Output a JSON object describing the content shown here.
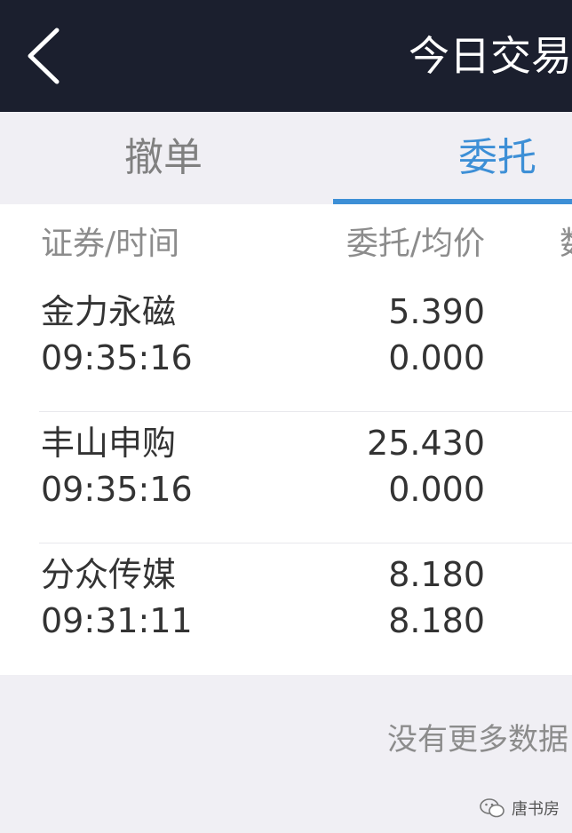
{
  "header": {
    "back_icon": "chevron-left-icon",
    "title": "今日交易"
  },
  "tabs": [
    {
      "label": "撤单",
      "active": false
    },
    {
      "label": "委托",
      "active": true
    }
  ],
  "accent_color": "#3d8fd6",
  "table": {
    "columns": [
      "证券/时间",
      "委托/均价",
      "数"
    ],
    "rows": [
      {
        "name": "金力永磁",
        "time": "09:35:16",
        "price": "5.390",
        "avg": "0.000"
      },
      {
        "name": "丰山申购",
        "time": "09:35:16",
        "price": "25.430",
        "avg": "0.000"
      },
      {
        "name": "分众传媒",
        "time": "09:31:11",
        "price": "8.180",
        "avg": "8.180"
      }
    ]
  },
  "footer": {
    "no_more": "没有更多数据"
  },
  "watermark": {
    "icon": "wechat-icon",
    "text": "唐书房"
  }
}
